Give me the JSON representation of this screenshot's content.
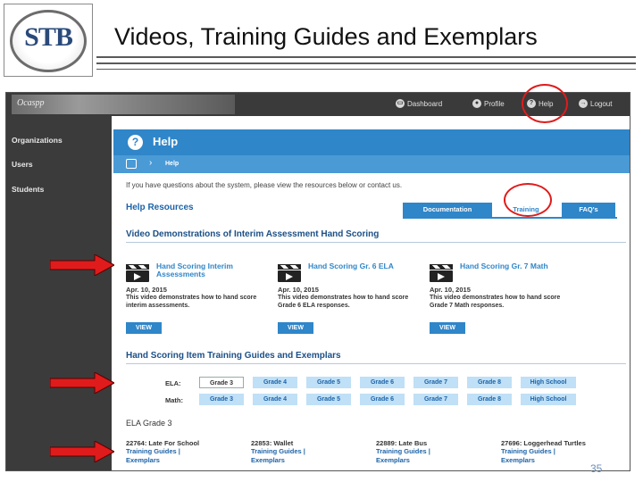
{
  "slide": {
    "logo_text": "STB",
    "title": "Videos, Training Guides and Exemplars",
    "page_number": "35"
  },
  "app": {
    "brand": "Ocaspp",
    "nav": [
      {
        "label": "Dashboard",
        "icon": "monitor-icon"
      },
      {
        "label": "Profile",
        "icon": "user-icon"
      },
      {
        "label": "Help",
        "icon": "help-icon"
      },
      {
        "label": "Logout",
        "icon": "logout-icon"
      }
    ],
    "sidebar": [
      "Organizations",
      "Users",
      "Students"
    ],
    "page_title": "Help",
    "breadcrumb": "Help",
    "intro": "If you have questions about the system, please view the resources below or contact us.",
    "resources_title": "Help Resources",
    "tabs": [
      "Documentation",
      "Training",
      "FAQ's"
    ],
    "video_section": "Video Demonstrations of Interim Assessment Hand Scoring",
    "videos": [
      {
        "title": "Hand Scoring Interim Assessments",
        "date": "Apr. 10, 2015",
        "desc": "This video demonstrates how to hand score interim assessments.",
        "button": "VIEW"
      },
      {
        "title": "Hand Scoring Gr. 6 ELA",
        "date": "Apr. 10, 2015",
        "desc": "This video demonstrates how to hand score Grade 6 ELA responses.",
        "button": "VIEW"
      },
      {
        "title": "Hand Scoring Gr. 7 Math",
        "date": "Apr. 10, 2015",
        "desc": "This video demonstrates how to hand score Grade 7 Math responses.",
        "button": "VIEW"
      }
    ],
    "guides_section": "Hand Scoring Item Training Guides and Exemplars",
    "ela_label": "ELA:",
    "math_label": "Math:",
    "ela_grades": [
      "Grade 3",
      "Grade 4",
      "Grade 5",
      "Grade 6",
      "Grade 7",
      "Grade 8",
      "High School"
    ],
    "math_grades": [
      "Grade 3",
      "Grade 4",
      "Grade 5",
      "Grade 6",
      "Grade 7",
      "Grade 8",
      "High School"
    ],
    "selected_heading": "ELA Grade 3",
    "items": [
      {
        "title": "22764: Late For School",
        "guide": "Training Guides |",
        "exemplars": "Exemplars"
      },
      {
        "title": "22853: Wallet",
        "guide": "Training Guides |",
        "exemplars": "Exemplars"
      },
      {
        "title": "22889: Late Bus",
        "guide": "Training Guides |",
        "exemplars": "Exemplars"
      },
      {
        "title": "27696: Loggerhead Turtles",
        "guide": "Training Guides |",
        "exemplars": "Exemplars"
      }
    ]
  },
  "colors": {
    "accent": "#2f86c9",
    "highlight": "#e01b1b",
    "sidebar": "#3b3b3b"
  }
}
